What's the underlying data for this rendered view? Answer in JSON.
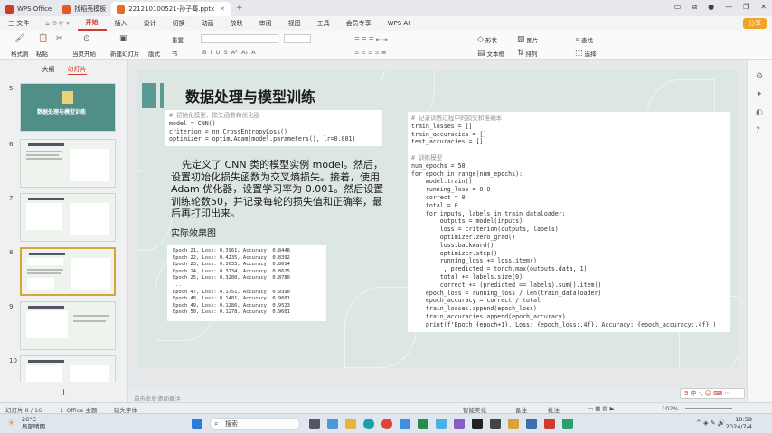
{
  "tabs": [
    {
      "label": "WPS Office",
      "color": "#d03b2b"
    },
    {
      "label": "找稻壳模板",
      "color": "#e05a2c"
    },
    {
      "label": "221210100521-孙子骞.pptx",
      "color": "#e66a2c"
    }
  ],
  "menu": [
    "三 文件",
    "开始",
    "插入",
    "设计",
    "切换",
    "动画",
    "放映",
    "审阅",
    "视图",
    "工具",
    "会员专享",
    "WPS AI"
  ],
  "share_label": "分享",
  "ribbon": {
    "format_painter": "格式刷",
    "paste": "粘贴",
    "cut": "✂",
    "play_from_current": "当页开始",
    "new_slide": "新建幻灯片",
    "layout": "版式",
    "section": "节",
    "reset": "重置",
    "shapes": "形状",
    "picture": "图片",
    "find": "查找",
    "textbox": "文本框",
    "arrange": "排列",
    "select": "选择"
  },
  "panel_tabs": [
    "大纲",
    "幻灯片"
  ],
  "thumbs": [
    {
      "num": "5",
      "label": "数据处理与模型训练"
    },
    {
      "num": "6"
    },
    {
      "num": "7"
    },
    {
      "num": "8"
    },
    {
      "num": "9"
    },
    {
      "num": "10"
    }
  ],
  "slide": {
    "title": "数据处理与模型训练",
    "code1": {
      "comment": "# 初始化模型、损失函数和优化器",
      "lines": [
        "model = CNN()",
        "criterion = nn.CrossEntropyLoss()",
        "optimizer = optim.Adam(model.parameters(), lr=0.001)"
      ]
    },
    "description": "先定义了 CNN 类的模型实例 model。然后，设置初始化损失函数为交叉熵损失。接着，使用 Adam 优化器，设置学习率为 0.001。然后设置训练轮数50，并记录每轮的损失值和正确率，最后再打印出来。",
    "effect_label": "实际效果图",
    "results": [
      "Epoch 21, Loss: 0.3961, Accuracy: 0.8448",
      "Epoch 22, Loss: 0.4235, Accuracy: 0.8392",
      "Epoch 23, Loss: 0.3633, Accuracy: 0.8614",
      "Epoch 24, Loss: 0.3734, Accuracy: 0.8625",
      "Epoch 25, Loss: 0.3280, Accuracy: 0.8780",
      "...",
      "Epoch 47, Loss: 0.1751, Accuracy: 0.9390",
      "Epoch 48, Loss: 0.1401, Accuracy: 0.9601",
      "Epoch 49, Loss: 0.1286, Accuracy: 0.9523",
      "Epoch 50, Loss: 0.1278, Accuracy: 0.9601"
    ],
    "code2": {
      "comment1": "# 记录训练过程中的损失和准确率",
      "lines1": [
        "train_losses = []",
        "train_accuracies = []",
        "test_accuracies = []"
      ],
      "comment2": "# 训练模型",
      "lines2": [
        "num_epochs = 50",
        "for epoch in range(num_epochs):",
        "    model.train()",
        "    running_loss = 0.0",
        "    correct = 0",
        "    total = 0",
        "    for inputs, labels in train_dataloader:",
        "        outputs = model(inputs)",
        "        loss = criterion(outputs, labels)",
        "        optimizer.zero_grad()",
        "        loss.backward()",
        "        optimizer.step()",
        "        running_loss += loss.item()",
        "        _, predicted = torch.max(outputs.data, 1)",
        "        total += labels.size(0)",
        "        correct += (predicted == labels).sum().item()",
        "    epoch_loss = running_loss / len(train_dataloader)",
        "    epoch_accuracy = correct / total",
        "    train_losses.append(epoch_loss)",
        "    train_accuracies.append(epoch_accuracy)",
        "    print(f'Epoch {epoch+1}, Loss: {epoch_loss:.4f}, Accuracy: {epoch_accuracy:.4f}')"
      ]
    }
  },
  "notes_hint": "单击此处添加备注",
  "status": {
    "slide_pos": "幻灯片 8 / 16",
    "theme": "1_Office 主题",
    "missing_font": "缺失字体",
    "smart_beautify": "智能美化",
    "notes": "备注",
    "comments": "批注",
    "zoom": "102%"
  },
  "taskbar": {
    "temp": "26°C",
    "weather": "局部晴朗",
    "search": "搜索",
    "time": "10:58",
    "date": "2024/7/4"
  }
}
